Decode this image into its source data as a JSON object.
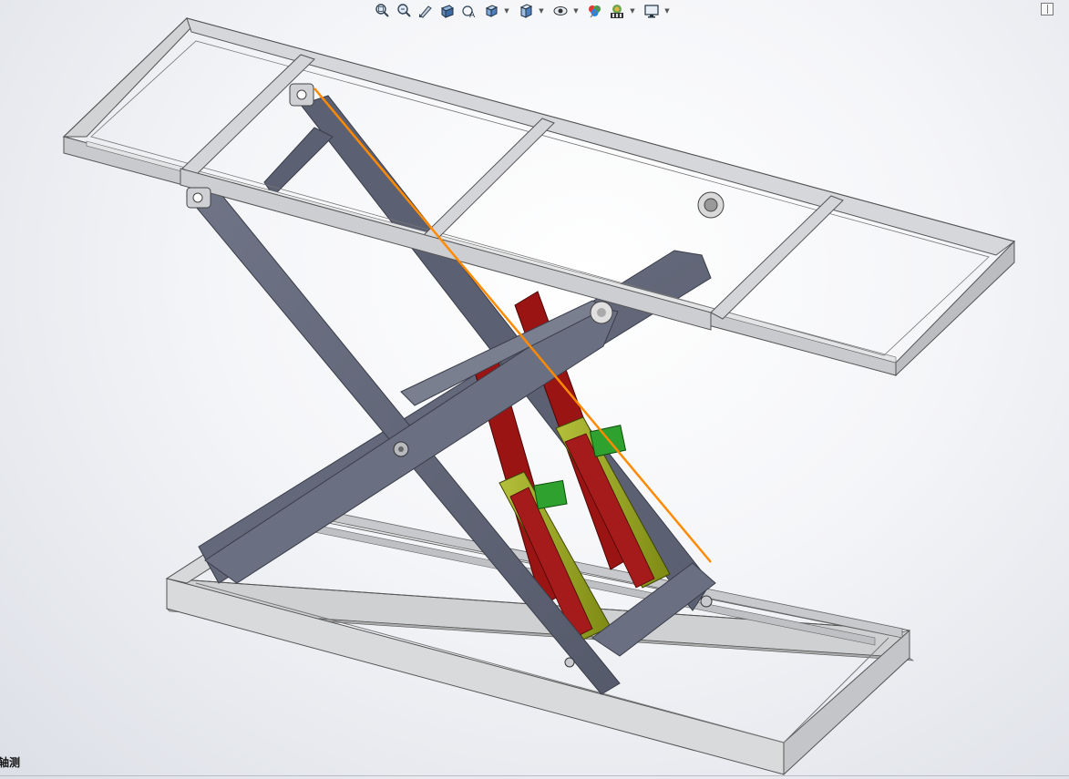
{
  "toolbar": {
    "items": [
      {
        "icon": "zoom-to-fit-icon",
        "dropdown": false
      },
      {
        "icon": "zoom-to-area-icon",
        "dropdown": false
      },
      {
        "icon": "previous-view-icon",
        "dropdown": false
      },
      {
        "icon": "section-view-icon",
        "dropdown": false
      },
      {
        "icon": "dynamic-annotation-views-icon",
        "dropdown": false
      },
      {
        "icon": "view-orientation-icon",
        "dropdown": true
      },
      {
        "icon": "display-style-icon",
        "dropdown": true
      },
      {
        "icon": "hide-show-items-icon",
        "dropdown": true
      },
      {
        "icon": "edit-appearance-icon",
        "dropdown": false
      },
      {
        "icon": "apply-scene-icon",
        "dropdown": true
      },
      {
        "icon": "view-settings-icon",
        "dropdown": true
      }
    ]
  },
  "viewport": {
    "orientation_label": "轴测"
  },
  "colors": {
    "frame": "#d2d3d5",
    "scissor_arm": "#626779",
    "cylinder_body": "#8f9c1c",
    "cylinder_rod": "#9a1414",
    "cylinder_block": "#2ea12e",
    "highlight_line": "#ff8a00"
  }
}
